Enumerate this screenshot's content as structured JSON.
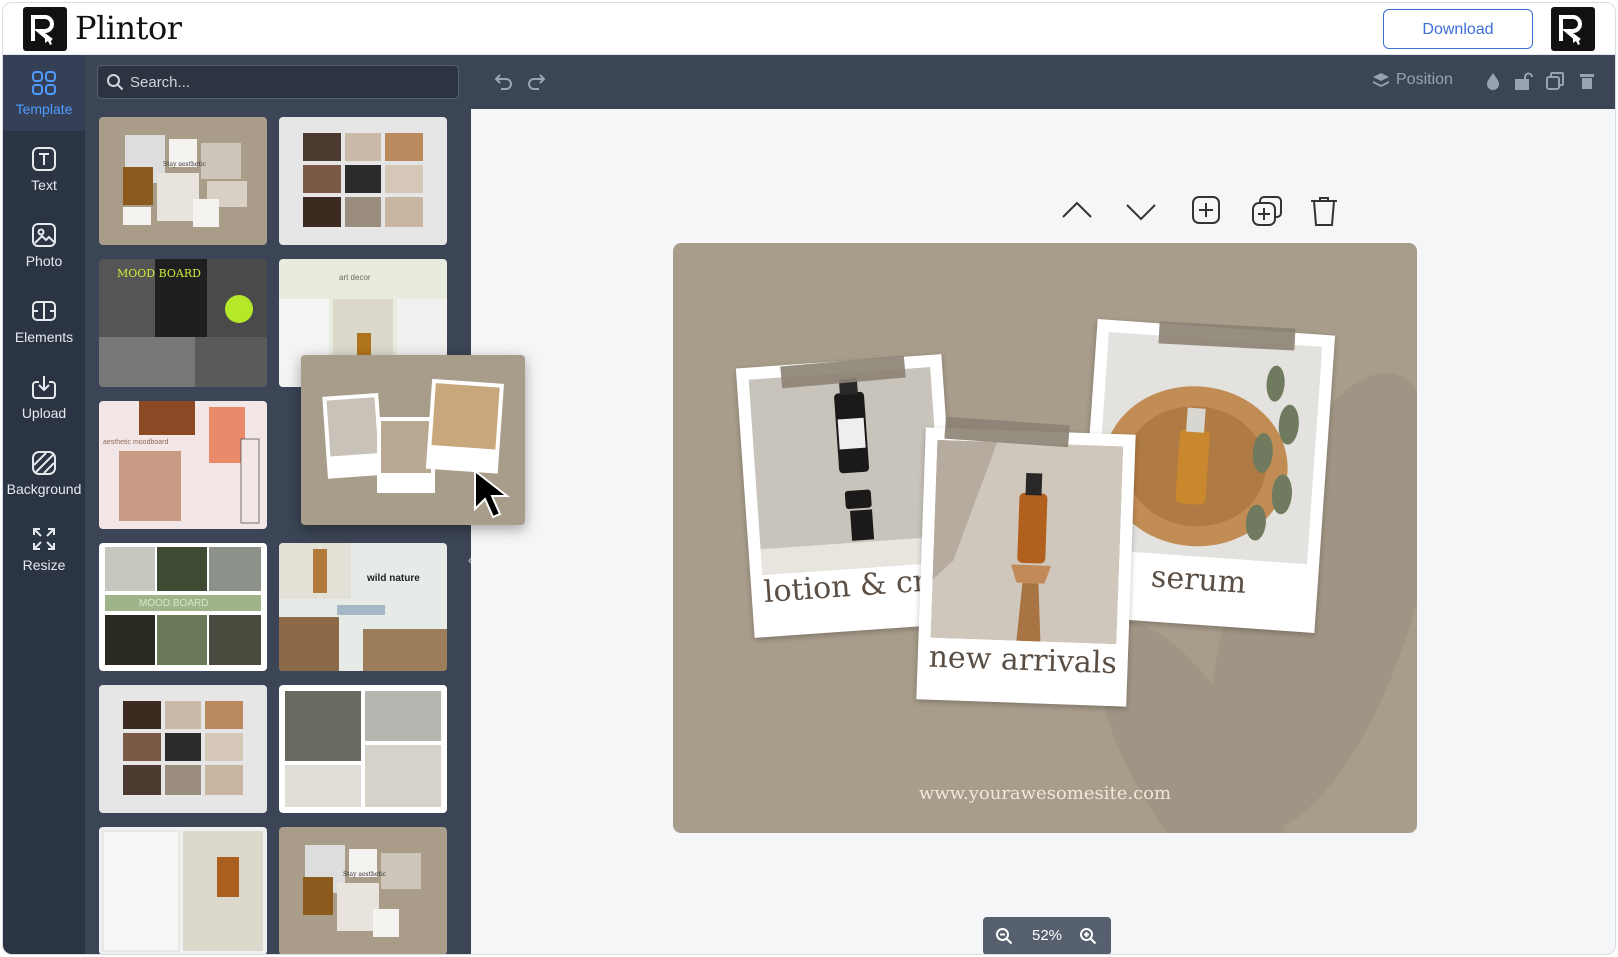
{
  "app": {
    "name": "Plintor"
  },
  "header": {
    "download_label": "Download"
  },
  "sidebar": {
    "items": [
      {
        "label": "Template",
        "icon": "grid-icon"
      },
      {
        "label": "Text",
        "icon": "text-icon"
      },
      {
        "label": "Photo",
        "icon": "photo-icon"
      },
      {
        "label": "Elements",
        "icon": "elements-icon"
      },
      {
        "label": "Upload",
        "icon": "upload-icon"
      },
      {
        "label": "Background",
        "icon": "background-icon"
      },
      {
        "label": "Resize",
        "icon": "resize-icon"
      }
    ],
    "active": "Template"
  },
  "panel": {
    "search_placeholder": "Search...",
    "templates": [
      {
        "bg": "#a99d8a",
        "text": "Stay aesthetic"
      },
      {
        "bg": "#e6e6e6",
        "text": ""
      },
      {
        "bg": "#3a3a3a",
        "text": "MOOD BOARD"
      },
      {
        "bg": "#e8ecdf",
        "text": "art decor"
      },
      {
        "bg": "#f2e7e6",
        "text": "aesthetic moodboard"
      },
      {
        "bg": "#a89c8b",
        "text": ""
      },
      {
        "bg": "#ffffff",
        "text": "MOOD BOARD"
      },
      {
        "bg": "#e7ebe8",
        "text": "wild nature"
      },
      {
        "bg": "#e6e6e6",
        "text": ""
      },
      {
        "bg": "#ffffff",
        "text": ""
      },
      {
        "bg": "#f0f0f0",
        "text": ""
      },
      {
        "bg": "#a99d8a",
        "text": "Stay aesthetic"
      }
    ]
  },
  "toolbar": {
    "position_label": "Position"
  },
  "canvas": {
    "captions": [
      "lotion & cre",
      "new arrivals",
      "serum"
    ],
    "website": "www.yourawesomesite.com",
    "background_color": "#a89c8b"
  },
  "zoom": {
    "value": "52%"
  },
  "colors": {
    "accent": "#3b6fd6",
    "sidebar": "#2b3443",
    "panel": "#3b4555"
  }
}
